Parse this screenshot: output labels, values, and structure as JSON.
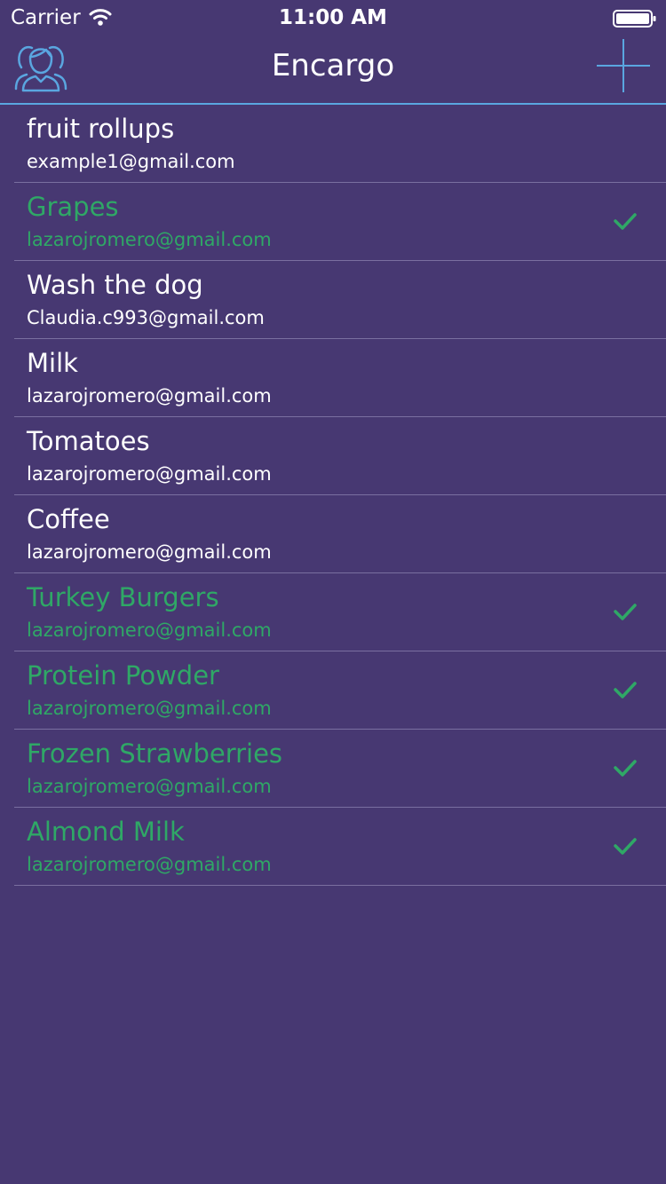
{
  "status_bar": {
    "carrier": "Carrier",
    "time": "11:00 AM",
    "wifi_icon": "wifi-icon",
    "battery_icon": "battery-icon"
  },
  "nav": {
    "title": "Encargo",
    "left_icon": "users-icon",
    "right_icon": "plus-icon",
    "accent_color": "#5aa6e0"
  },
  "colors": {
    "background": "#473872",
    "text": "#ffffff",
    "completed": "#2fa866",
    "separator": "#7a6fa0"
  },
  "items": [
    {
      "title": "fruit rollups",
      "subtitle": "example1@gmail.com",
      "done": false
    },
    {
      "title": "Grapes",
      "subtitle": "lazarojromero@gmail.com",
      "done": true
    },
    {
      "title": "Wash the dog",
      "subtitle": "Claudia.c993@gmail.com",
      "done": false
    },
    {
      "title": "Milk",
      "subtitle": "lazarojromero@gmail.com",
      "done": false
    },
    {
      "title": "Tomatoes",
      "subtitle": "lazarojromero@gmail.com",
      "done": false
    },
    {
      "title": "Coffee",
      "subtitle": "lazarojromero@gmail.com",
      "done": false
    },
    {
      "title": "Turkey Burgers",
      "subtitle": "lazarojromero@gmail.com",
      "done": true
    },
    {
      "title": "Protein Powder",
      "subtitle": "lazarojromero@gmail.com",
      "done": true
    },
    {
      "title": "Frozen Strawberries",
      "subtitle": "lazarojromero@gmail.com",
      "done": true
    },
    {
      "title": "Almond Milk",
      "subtitle": "lazarojromero@gmail.com",
      "done": true
    }
  ]
}
